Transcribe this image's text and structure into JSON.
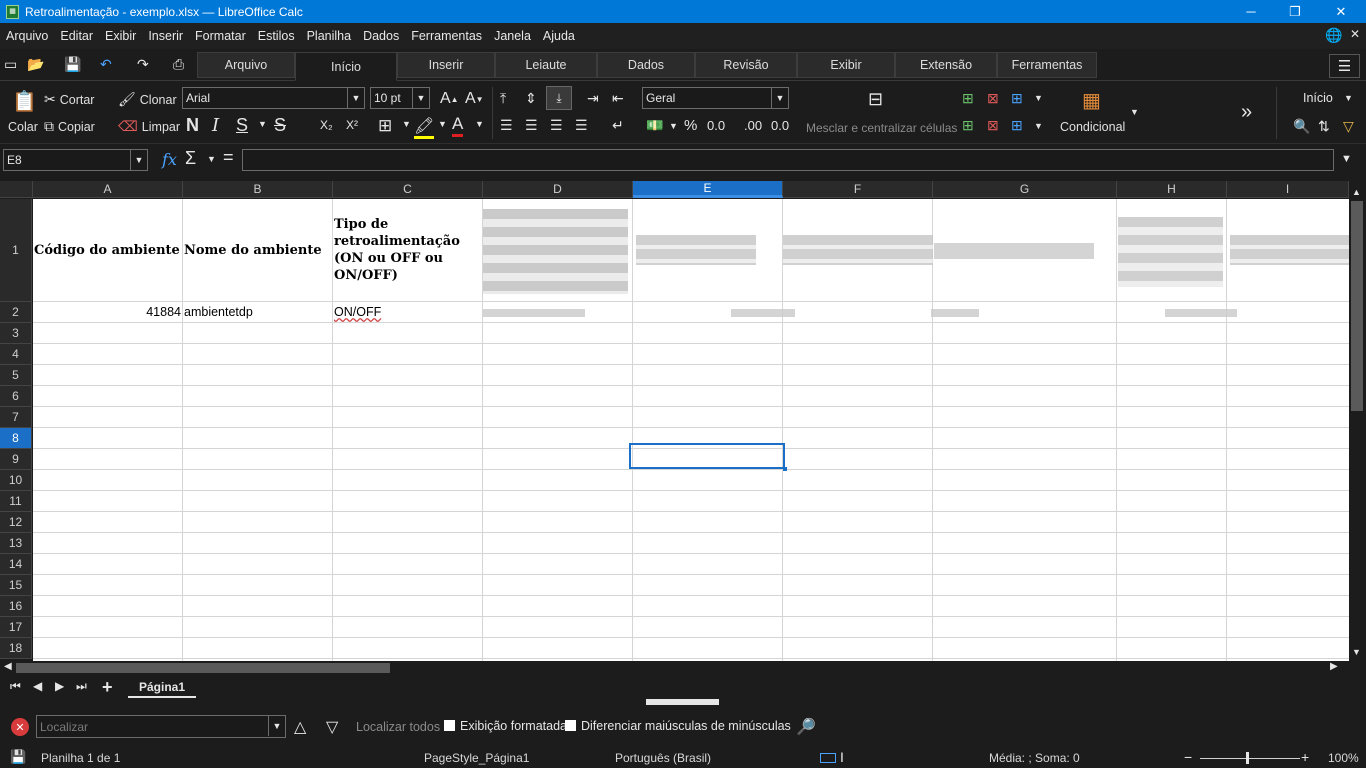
{
  "window": {
    "title": "Retroalimentação - exemplo.xlsx — LibreOffice Calc",
    "app_icon": "calc-icon"
  },
  "menu": [
    "Arquivo",
    "Editar",
    "Exibir",
    "Inserir",
    "Formatar",
    "Estilos",
    "Planilha",
    "Dados",
    "Ferramentas",
    "Janela",
    "Ajuda"
  ],
  "tabs": [
    "Arquivo",
    "Início",
    "Inserir",
    "Leiaute",
    "Dados",
    "Revisão",
    "Exibir",
    "Extensão",
    "Ferramentas"
  ],
  "active_tab": "Início",
  "ribbon": {
    "cut": "Cortar",
    "clone": "Clonar",
    "paste": "Colar",
    "copy": "Copiar",
    "clear": "Limpar",
    "font_name": "Arial",
    "font_size": "10 pt",
    "number_format": "Geral",
    "merge_center": "Mesclar e centralizar células",
    "conditional": "Condicional",
    "inicio_dropdown": "Início",
    "more": "»",
    "bold": "N",
    "italic": "I",
    "underline": "S",
    "strike": "S",
    "subscript": "X₂",
    "superscript": "X²",
    "percent": "%",
    "decimal": "0.0",
    "decimal2": ".00",
    "grow": "A",
    "shrink": "A"
  },
  "formula_bar": {
    "name_box": "E8",
    "fx": "fx",
    "sigma": "Σ",
    "equals": "=",
    "formula": ""
  },
  "grid": {
    "columns": [
      "A",
      "B",
      "C",
      "D",
      "E",
      "F",
      "G",
      "H",
      "I"
    ],
    "selected_column": "E",
    "rows": [
      "1",
      "2",
      "3",
      "4",
      "5",
      "6",
      "7",
      "8",
      "9",
      "10",
      "11",
      "12",
      "13",
      "14",
      "15",
      "16",
      "17",
      "18"
    ],
    "selected_row": "8",
    "cells": {
      "A1": "Código do ambiente",
      "B1": "Nome do ambiente",
      "C1": "Tipo de retroalimentação (ON ou OFF ou ON/OFF)",
      "A2": "41884",
      "B2": "ambientetdp",
      "C2": "ON/OFF"
    }
  },
  "sheet_tabs": {
    "active": "Página1"
  },
  "find": {
    "placeholder": "Localizar",
    "find_all": "Localizar todos",
    "formatted": "Exibição formatada",
    "match_case": "Diferenciar maiúsculas de minúsculas"
  },
  "status": {
    "sheet": "Planilha 1 de 1",
    "page_style": "PageStyle_Página1",
    "language": "Português (Brasil)",
    "summary": "Média: ; Soma: 0",
    "zoom": "100%",
    "zoom_level": 100
  }
}
